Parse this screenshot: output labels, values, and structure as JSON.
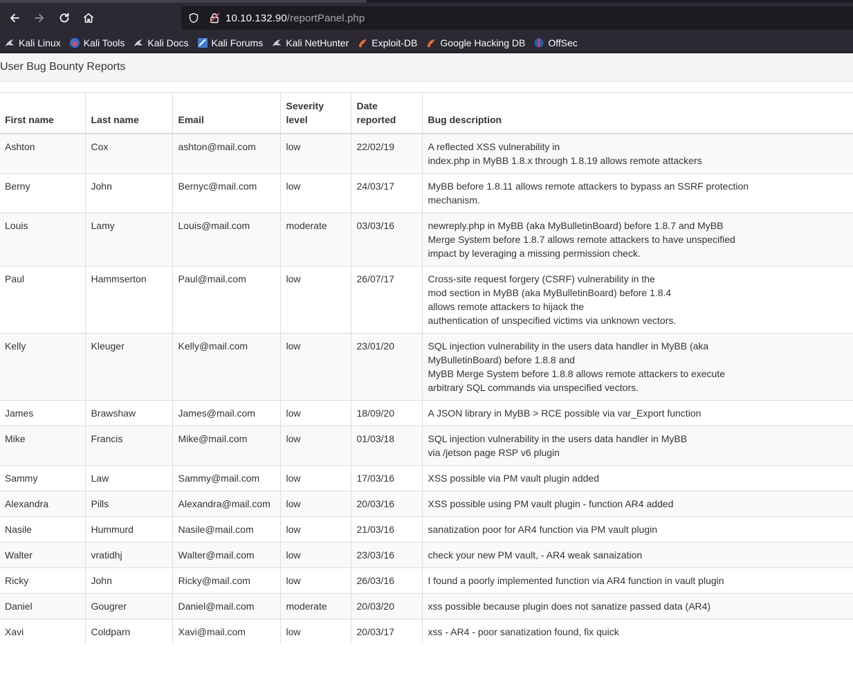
{
  "browser": {
    "url_host": "10.10.132.90",
    "url_path": "/reportPanel.php",
    "bookmarks": [
      {
        "label": "Kali Linux",
        "icon": "kali-dragon-icon"
      },
      {
        "label": "Kali Tools",
        "icon": "kali-tools-icon"
      },
      {
        "label": "Kali Docs",
        "icon": "kali-dragon-icon"
      },
      {
        "label": "Kali Forums",
        "icon": "kali-forums-icon"
      },
      {
        "label": "Kali NetHunter",
        "icon": "kali-dragon-icon"
      },
      {
        "label": "Exploit-DB",
        "icon": "exploit-db-icon"
      },
      {
        "label": "Google Hacking DB",
        "icon": "exploit-db-icon"
      },
      {
        "label": "OffSec",
        "icon": "offsec-icon"
      }
    ]
  },
  "page": {
    "heading": "User Bug Bounty Reports",
    "table": {
      "headers": {
        "first": "First name",
        "last": "Last name",
        "email": "Email",
        "severity": "Severity level",
        "date": "Date reported",
        "desc": "Bug description"
      },
      "rows": [
        {
          "first": "Ashton",
          "last": "Cox",
          "email": "ashton@mail.com",
          "severity": "low",
          "date": "22/02/19",
          "desc": "A reflected XSS vulnerability in\nindex.php in MyBB 1.8.x through 1.8.19 allows remote attackers"
        },
        {
          "first": "Berny",
          "last": "John",
          "email": "Bernyc@mail.com",
          "severity": "low",
          "date": "24/03/17",
          "desc": "MyBB before 1.8.11 allows remote attackers to bypass an SSRF protection\nmechanism."
        },
        {
          "first": "Louis",
          "last": "Lamy",
          "email": "Louis@mail.com",
          "severity": "moderate",
          "date": "03/03/16",
          "desc": "newreply.php in MyBB (aka MyBulletinBoard) before 1.8.7 and MyBB\nMerge System before 1.8.7 allows remote attackers to have unspecified\nimpact by leveraging a missing permission check."
        },
        {
          "first": "Paul",
          "last": "Hammserton",
          "email": "Paul@mail.com",
          "severity": "low",
          "date": "26/07/17",
          "desc": "Cross-site request forgery (CSRF) vulnerability in the\nmod section in MyBB (aka MyBulletinBoard) before 1.8.4\nallows remote attackers to hijack the\nauthentication of unspecified victims via unknown vectors."
        },
        {
          "first": "Kelly",
          "last": "Kleuger",
          "email": "Kelly@mail.com",
          "severity": "low",
          "date": "23/01/20",
          "desc": "SQL injection vulnerability in the users data handler in MyBB (aka\nMyBulletinBoard) before 1.8.8 and\nMyBB Merge System before 1.8.8 allows remote attackers to execute\narbitrary SQL commands via unspecified vectors."
        },
        {
          "first": "James",
          "last": "Brawshaw",
          "email": "James@mail.com",
          "severity": "low",
          "date": "18/09/20",
          "desc": "A JSON library in MyBB > RCE possible via var_Export function"
        },
        {
          "first": "Mike",
          "last": "Francis",
          "email": "Mike@mail.com",
          "severity": "low",
          "date": "01/03/18",
          "desc": "SQL injection vulnerability in the users data handler in MyBB\nvia /jetson page RSP v6 plugin"
        },
        {
          "first": "Sammy",
          "last": "Law",
          "email": "Sammy@mail.com",
          "severity": "low",
          "date": "17/03/16",
          "desc": "XSS possible via PM vault plugin added"
        },
        {
          "first": "Alexandra",
          "last": "Pills",
          "email": "Alexandra@mail.com",
          "severity": "low",
          "date": "20/03/16",
          "desc": "XSS possible using PM vault plugin - function AR4 added"
        },
        {
          "first": "Nasile",
          "last": "Hummurd",
          "email": "Nasile@mail.com",
          "severity": "low",
          "date": "21/03/16",
          "desc": "sanatization poor for AR4 function via PM vault plugin"
        },
        {
          "first": "Walter",
          "last": "vratidhj",
          "email": "Walter@mail.com",
          "severity": "low",
          "date": "23/03/16",
          "desc": "check your new PM vault, - AR4 weak sanaization"
        },
        {
          "first": "Ricky",
          "last": "John",
          "email": "Ricky@mail.com",
          "severity": "low",
          "date": "26/03/16",
          "desc": "I found a poorly implemented function via AR4 function in vault plugin"
        },
        {
          "first": "Daniel",
          "last": "Gougrer",
          "email": "Daniel@mail.com",
          "severity": "moderate",
          "date": "20/03/20",
          "desc": "xss possible because plugin does not sanatize passed data (AR4)"
        },
        {
          "first": "Xavi",
          "last": "Coldparn",
          "email": "Xavi@mail.com",
          "severity": "low",
          "date": "20/03/17",
          "desc": "xss - AR4 - poor sanatization found, fix quick"
        }
      ]
    }
  }
}
